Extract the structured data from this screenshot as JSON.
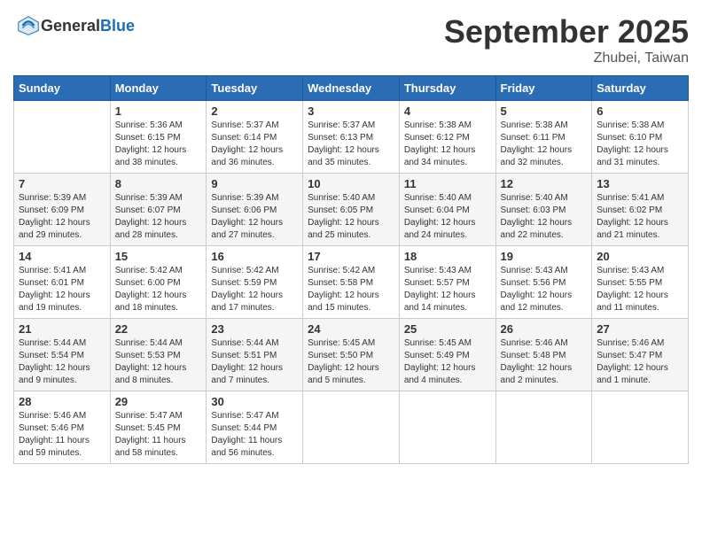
{
  "header": {
    "logo_general": "General",
    "logo_blue": "Blue",
    "month_title": "September 2025",
    "location": "Zhubei, Taiwan"
  },
  "days_of_week": [
    "Sunday",
    "Monday",
    "Tuesday",
    "Wednesday",
    "Thursday",
    "Friday",
    "Saturday"
  ],
  "weeks": [
    [
      {
        "day": "",
        "info": ""
      },
      {
        "day": "1",
        "info": "Sunrise: 5:36 AM\nSunset: 6:15 PM\nDaylight: 12 hours\nand 38 minutes."
      },
      {
        "day": "2",
        "info": "Sunrise: 5:37 AM\nSunset: 6:14 PM\nDaylight: 12 hours\nand 36 minutes."
      },
      {
        "day": "3",
        "info": "Sunrise: 5:37 AM\nSunset: 6:13 PM\nDaylight: 12 hours\nand 35 minutes."
      },
      {
        "day": "4",
        "info": "Sunrise: 5:38 AM\nSunset: 6:12 PM\nDaylight: 12 hours\nand 34 minutes."
      },
      {
        "day": "5",
        "info": "Sunrise: 5:38 AM\nSunset: 6:11 PM\nDaylight: 12 hours\nand 32 minutes."
      },
      {
        "day": "6",
        "info": "Sunrise: 5:38 AM\nSunset: 6:10 PM\nDaylight: 12 hours\nand 31 minutes."
      }
    ],
    [
      {
        "day": "7",
        "info": "Sunrise: 5:39 AM\nSunset: 6:09 PM\nDaylight: 12 hours\nand 29 minutes."
      },
      {
        "day": "8",
        "info": "Sunrise: 5:39 AM\nSunset: 6:07 PM\nDaylight: 12 hours\nand 28 minutes."
      },
      {
        "day": "9",
        "info": "Sunrise: 5:39 AM\nSunset: 6:06 PM\nDaylight: 12 hours\nand 27 minutes."
      },
      {
        "day": "10",
        "info": "Sunrise: 5:40 AM\nSunset: 6:05 PM\nDaylight: 12 hours\nand 25 minutes."
      },
      {
        "day": "11",
        "info": "Sunrise: 5:40 AM\nSunset: 6:04 PM\nDaylight: 12 hours\nand 24 minutes."
      },
      {
        "day": "12",
        "info": "Sunrise: 5:40 AM\nSunset: 6:03 PM\nDaylight: 12 hours\nand 22 minutes."
      },
      {
        "day": "13",
        "info": "Sunrise: 5:41 AM\nSunset: 6:02 PM\nDaylight: 12 hours\nand 21 minutes."
      }
    ],
    [
      {
        "day": "14",
        "info": "Sunrise: 5:41 AM\nSunset: 6:01 PM\nDaylight: 12 hours\nand 19 minutes."
      },
      {
        "day": "15",
        "info": "Sunrise: 5:42 AM\nSunset: 6:00 PM\nDaylight: 12 hours\nand 18 minutes."
      },
      {
        "day": "16",
        "info": "Sunrise: 5:42 AM\nSunset: 5:59 PM\nDaylight: 12 hours\nand 17 minutes."
      },
      {
        "day": "17",
        "info": "Sunrise: 5:42 AM\nSunset: 5:58 PM\nDaylight: 12 hours\nand 15 minutes."
      },
      {
        "day": "18",
        "info": "Sunrise: 5:43 AM\nSunset: 5:57 PM\nDaylight: 12 hours\nand 14 minutes."
      },
      {
        "day": "19",
        "info": "Sunrise: 5:43 AM\nSunset: 5:56 PM\nDaylight: 12 hours\nand 12 minutes."
      },
      {
        "day": "20",
        "info": "Sunrise: 5:43 AM\nSunset: 5:55 PM\nDaylight: 12 hours\nand 11 minutes."
      }
    ],
    [
      {
        "day": "21",
        "info": "Sunrise: 5:44 AM\nSunset: 5:54 PM\nDaylight: 12 hours\nand 9 minutes."
      },
      {
        "day": "22",
        "info": "Sunrise: 5:44 AM\nSunset: 5:53 PM\nDaylight: 12 hours\nand 8 minutes."
      },
      {
        "day": "23",
        "info": "Sunrise: 5:44 AM\nSunset: 5:51 PM\nDaylight: 12 hours\nand 7 minutes."
      },
      {
        "day": "24",
        "info": "Sunrise: 5:45 AM\nSunset: 5:50 PM\nDaylight: 12 hours\nand 5 minutes."
      },
      {
        "day": "25",
        "info": "Sunrise: 5:45 AM\nSunset: 5:49 PM\nDaylight: 12 hours\nand 4 minutes."
      },
      {
        "day": "26",
        "info": "Sunrise: 5:46 AM\nSunset: 5:48 PM\nDaylight: 12 hours\nand 2 minutes."
      },
      {
        "day": "27",
        "info": "Sunrise: 5:46 AM\nSunset: 5:47 PM\nDaylight: 12 hours\nand 1 minute."
      }
    ],
    [
      {
        "day": "28",
        "info": "Sunrise: 5:46 AM\nSunset: 5:46 PM\nDaylight: 11 hours\nand 59 minutes."
      },
      {
        "day": "29",
        "info": "Sunrise: 5:47 AM\nSunset: 5:45 PM\nDaylight: 11 hours\nand 58 minutes."
      },
      {
        "day": "30",
        "info": "Sunrise: 5:47 AM\nSunset: 5:44 PM\nDaylight: 11 hours\nand 56 minutes."
      },
      {
        "day": "",
        "info": ""
      },
      {
        "day": "",
        "info": ""
      },
      {
        "day": "",
        "info": ""
      },
      {
        "day": "",
        "info": ""
      }
    ]
  ]
}
